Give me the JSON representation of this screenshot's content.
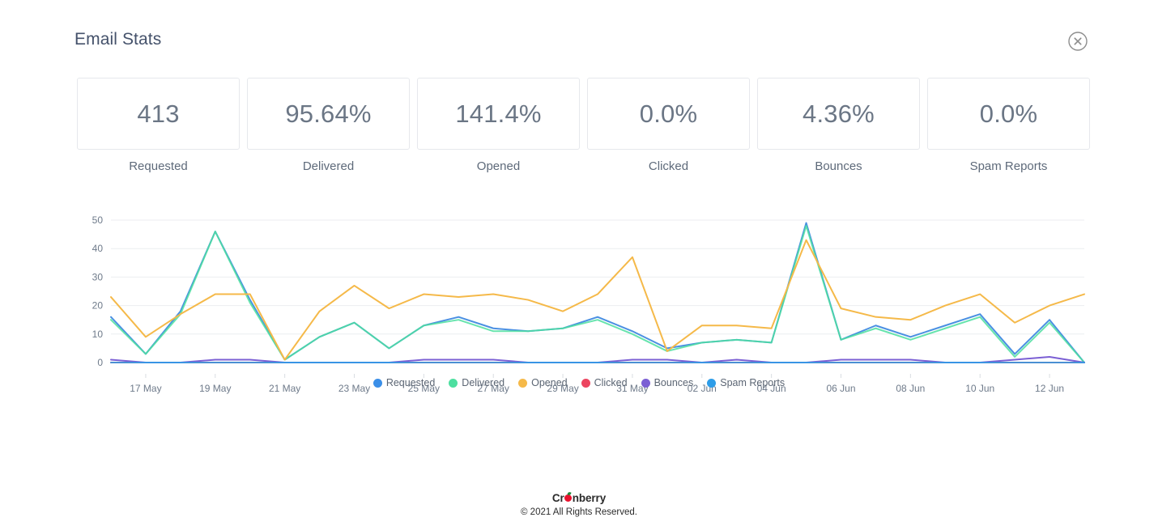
{
  "header": {
    "title": "Email Stats",
    "close_icon": "close-circle-icon"
  },
  "stats": [
    {
      "value": "413",
      "label": "Requested"
    },
    {
      "value": "95.64%",
      "label": "Delivered"
    },
    {
      "value": "141.4%",
      "label": "Opened"
    },
    {
      "value": "0.0%",
      "label": "Clicked"
    },
    {
      "value": "4.36%",
      "label": "Bounces"
    },
    {
      "value": "0.0%",
      "label": "Spam Reports"
    }
  ],
  "legend": [
    {
      "label": "Requested",
      "color": "#3b8fe8"
    },
    {
      "label": "Delivered",
      "color": "#4ddfa0"
    },
    {
      "label": "Opened",
      "color": "#f5b949"
    },
    {
      "label": "Clicked",
      "color": "#ec4560"
    },
    {
      "label": "Bounces",
      "color": "#7b5fd4"
    },
    {
      "label": "Spam Reports",
      "color": "#2e9de8"
    }
  ],
  "footer": {
    "brand_before": "Cr",
    "brand_after": "nberry",
    "copyright": "© 2021 All Rights Reserved."
  },
  "chart_data": {
    "type": "line",
    "title": "",
    "xlabel": "",
    "ylabel": "",
    "ylim": [
      0,
      50
    ],
    "yticks": [
      0,
      10,
      20,
      30,
      40,
      50
    ],
    "grid": true,
    "legend_position": "bottom",
    "x": [
      "16 May",
      "17 May",
      "18 May",
      "19 May",
      "20 May",
      "21 May",
      "22 May",
      "23 May",
      "24 May",
      "25 May",
      "26 May",
      "27 May",
      "28 May",
      "29 May",
      "30 May",
      "31 May",
      "01 Jun",
      "02 Jun",
      "03 Jun",
      "04 Jun",
      "05 Jun",
      "06 Jun",
      "07 Jun",
      "08 Jun",
      "09 Jun",
      "10 Jun",
      "11 Jun",
      "12 Jun",
      "13 Jun"
    ],
    "xtick_labels": [
      "17 May",
      "19 May",
      "21 May",
      "23 May",
      "25 May",
      "27 May",
      "29 May",
      "31 May",
      "02 Jun",
      "04 Jun",
      "06 Jun",
      "08 Jun",
      "10 Jun",
      "12 Jun"
    ],
    "xtick_indices": [
      1,
      3,
      5,
      7,
      9,
      11,
      13,
      15,
      17,
      19,
      21,
      23,
      25,
      27
    ],
    "series": [
      {
        "name": "Requested",
        "color": "#4a90e2",
        "values": [
          16,
          3,
          18,
          46,
          22,
          1,
          9,
          14,
          5,
          13,
          16,
          12,
          11,
          12,
          16,
          11,
          5,
          7,
          8,
          7,
          49,
          8,
          13,
          9,
          13,
          17,
          3,
          15,
          0
        ]
      },
      {
        "name": "Delivered",
        "color": "#4ddfa0",
        "values": [
          15,
          3,
          17,
          46,
          21,
          1,
          9,
          14,
          5,
          13,
          15,
          11,
          11,
          12,
          15,
          10,
          4,
          7,
          8,
          7,
          48,
          8,
          12,
          8,
          12,
          16,
          2,
          14,
          0
        ]
      },
      {
        "name": "Opened",
        "color": "#f5b949",
        "values": [
          23,
          9,
          17,
          24,
          24,
          1,
          18,
          27,
          19,
          24,
          23,
          24,
          22,
          18,
          24,
          37,
          4,
          13,
          13,
          12,
          43,
          19,
          16,
          15,
          20,
          24,
          14,
          20,
          24
        ]
      },
      {
        "name": "Clicked",
        "color": "#ec4560",
        "values": [
          0,
          0,
          0,
          0,
          0,
          0,
          0,
          0,
          0,
          0,
          0,
          0,
          0,
          0,
          0,
          0,
          0,
          0,
          0,
          0,
          0,
          0,
          0,
          0,
          0,
          0,
          0,
          0,
          0
        ]
      },
      {
        "name": "Bounces",
        "color": "#7b5fd4",
        "values": [
          1,
          0,
          0,
          1,
          1,
          0,
          0,
          0,
          0,
          1,
          1,
          1,
          0,
          0,
          0,
          1,
          1,
          0,
          1,
          0,
          0,
          1,
          1,
          1,
          0,
          0,
          1,
          2,
          0
        ]
      },
      {
        "name": "Spam Reports",
        "color": "#2e9de8",
        "values": [
          0,
          0,
          0,
          0,
          0,
          0,
          0,
          0,
          0,
          0,
          0,
          0,
          0,
          0,
          0,
          0,
          0,
          0,
          0,
          0,
          0,
          0,
          0,
          0,
          0,
          0,
          0,
          0,
          0
        ]
      }
    ]
  }
}
